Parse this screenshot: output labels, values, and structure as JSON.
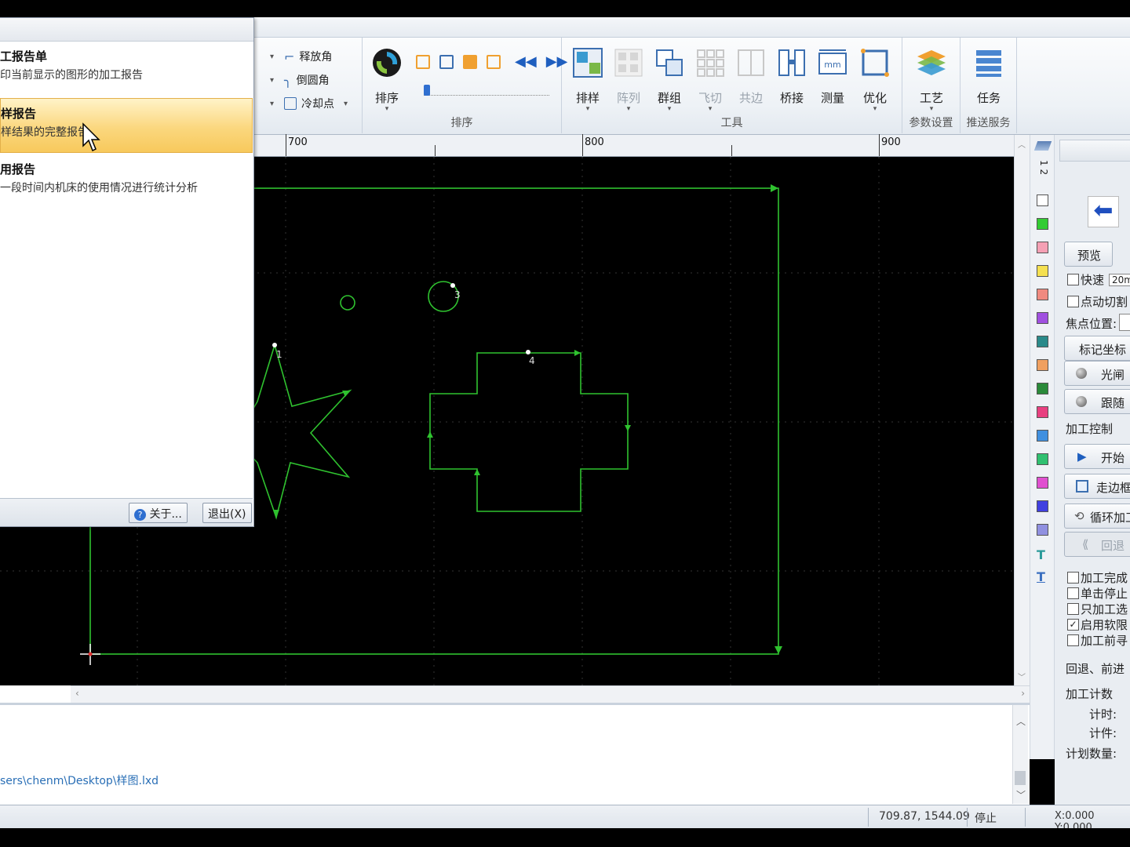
{
  "ribbon": {
    "small_items": [
      "释放角",
      "倒圆角",
      "冷却点"
    ],
    "sort_group": {
      "label": "排序",
      "button": "排序"
    },
    "tools_group": {
      "label": "工具",
      "buttons": [
        "排样",
        "阵列",
        "群组",
        "飞切",
        "共边",
        "桥接",
        "测量",
        "优化"
      ]
    },
    "param_group": {
      "label": "参数设置",
      "button": "工艺"
    },
    "push_group": {
      "label": "推送服务",
      "button": "任务"
    }
  },
  "ruler": {
    "labels": [
      "700",
      "800",
      "900"
    ]
  },
  "popup": {
    "items": [
      {
        "title": "工报告单",
        "desc": "印当前显示的图形的加工报告"
      },
      {
        "title": "样报告",
        "desc": "样结果的完整报告"
      },
      {
        "title": "用报告",
        "desc": "一段时间内机床的使用情况进行统计分析"
      }
    ],
    "about_btn": "关于...",
    "exit_btn": "退出(X)"
  },
  "canvas": {
    "part_numbers": [
      "1",
      "3",
      "4"
    ]
  },
  "palette": {
    "label": "1 2",
    "colors": [
      "#ffffff",
      "#33cc33",
      "#f5a0b4",
      "#f5e050",
      "#f08a80",
      "#a050e0",
      "#2a8a8a",
      "#f0a060",
      "#2a8a3a",
      "#e84080",
      "#4090e0",
      "#30c070",
      "#e050d0",
      "#4040e0",
      "#9090e0"
    ]
  },
  "right_panel": {
    "preview": "预览",
    "fast_label": "快速",
    "fast_value": "20m",
    "jog_cut": "点动切割",
    "focus_label": "焦点位置:",
    "mark_coord": "标记坐标",
    "shutter": "光闸",
    "follow": "跟随",
    "process_control": "加工控制",
    "start": "开始",
    "trace_frame": "走边框",
    "loop": "循环加工",
    "back": "回退",
    "checkboxes": [
      {
        "label": "加工完成",
        "checked": false
      },
      {
        "label": "单击停止",
        "checked": false
      },
      {
        "label": "只加工选",
        "checked": false
      },
      {
        "label": "启用软限",
        "checked": true
      },
      {
        "label": "加工前寻",
        "checked": false
      }
    ],
    "back_forward": "回退、前进",
    "count_title": "加工计数",
    "timer": "计时:",
    "counter": "计件:",
    "plan_qty": "计划数量:"
  },
  "console": {
    "path": "sers\\chenm\\Desktop\\样图.lxd"
  },
  "status": {
    "coords": "709.87, 1544.09",
    "state": "停止",
    "machine_pos": "X:0.000 Y:0.000"
  }
}
